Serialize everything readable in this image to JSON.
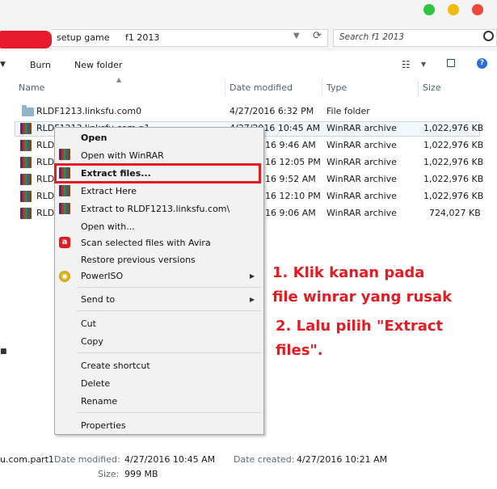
{
  "window": {
    "controls": {
      "green": "#2fc53e",
      "yellow": "#f2b90c",
      "red": "#ee4a3c"
    }
  },
  "address": {
    "crumbs": [
      "setup game",
      "f1 2013"
    ],
    "search_placeholder": "Search f1 2013"
  },
  "toolbar": {
    "burn": "Burn",
    "new_folder": "New folder"
  },
  "columns": {
    "name": "Name",
    "date": "Date modified",
    "type": "Type",
    "size": "Size"
  },
  "files": [
    {
      "name": "RLDF1213.linksfu.com0",
      "date": "4/27/2016 6:32 PM",
      "type": "File folder",
      "size": "",
      "icon": "folder-icon"
    },
    {
      "name": "RLDF1213.linksfu.com.p1",
      "date": "4/27/2016 10:45 AM",
      "type": "WinRAR archive",
      "size": "1,022,976 KB",
      "icon": "winrar-icon"
    },
    {
      "name": "RLD",
      "date": "16 9:46 AM",
      "type": "WinRAR archive",
      "size": "1,022,976 KB",
      "icon": "winrar-icon"
    },
    {
      "name": "RLD",
      "date": "16 12:05 PM",
      "type": "WinRAR archive",
      "size": "1,022,976 KB",
      "icon": "winrar-icon"
    },
    {
      "name": "RLD",
      "date": "16 9:52 AM",
      "type": "WinRAR archive",
      "size": "1,022,976 KB",
      "icon": "winrar-icon"
    },
    {
      "name": "RLD",
      "date": "16 12:10 PM",
      "type": "WinRAR archive",
      "size": "1,022,976 KB",
      "icon": "winrar-icon"
    },
    {
      "name": "RLD",
      "date": "16 9:06 AM",
      "type": "WinRAR archive",
      "size": "724,027 KB",
      "icon": "winrar-icon"
    }
  ],
  "context_menu": {
    "open": "Open",
    "open_with_winrar": "Open with WinRAR",
    "extract_files": "Extract files...",
    "extract_here": "Extract Here",
    "extract_to": "Extract to RLDF1213.linksfu.com\\",
    "open_with": "Open with...",
    "scan_avira": "Scan selected files with Avira",
    "restore_versions": "Restore previous versions",
    "poweriso": "PowerISO",
    "send_to": "Send to",
    "cut": "Cut",
    "copy": "Copy",
    "create_shortcut": "Create shortcut",
    "delete": "Delete",
    "rename": "Rename",
    "properties": "Properties"
  },
  "annotation": {
    "step1_line1": "1. Klik kanan pada",
    "step1_line2": "file winrar yang rusak",
    "step2_line1": "2. Lalu pilih \"Extract",
    "step2_line2": "files\".",
    "color": "#e31c24"
  },
  "details": {
    "filename": "u.com.part1",
    "date_modified_label": "Date modified:",
    "date_modified": "4/27/2016 10:45 AM",
    "date_created_label": "Date created:",
    "date_created": "4/27/2016 10:21 AM",
    "size_label": "Size:",
    "size": "999 MB"
  }
}
